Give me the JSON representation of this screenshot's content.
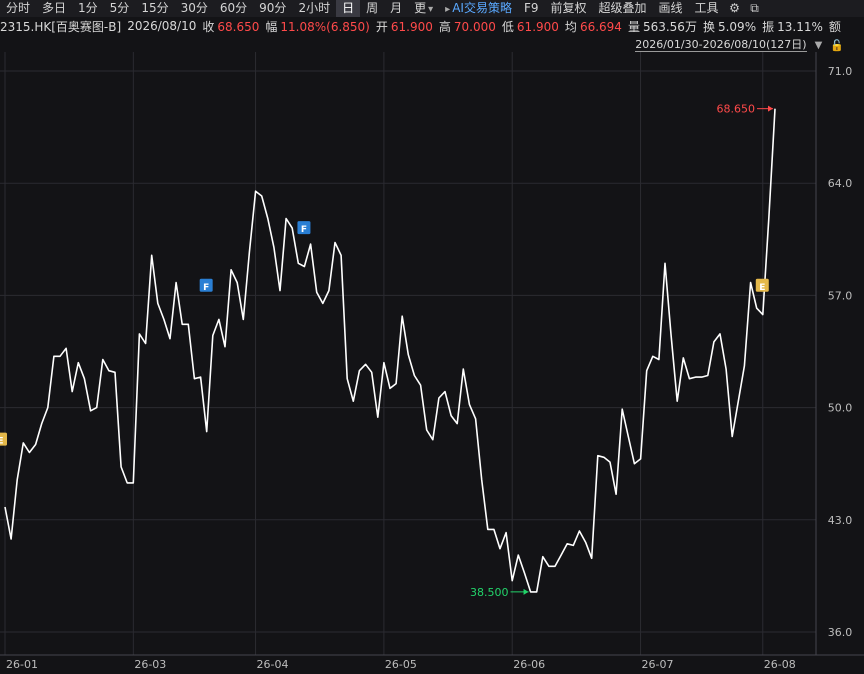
{
  "toolbar": {
    "items": [
      "分时",
      "多日",
      "1分",
      "5分",
      "15分",
      "30分",
      "60分",
      "90分",
      "2小时",
      "日",
      "周",
      "月",
      "更",
      "AI交易策略",
      "F9",
      "前复权",
      "超级叠加",
      "画线",
      "工具"
    ],
    "active": "日",
    "accent": "AI交易策略",
    "icons": [
      "gear-icon",
      "copy-icon"
    ]
  },
  "quote": {
    "symbol": "2315.HK[百奥赛图-B]",
    "date": "2026/08/10",
    "close_label": "收",
    "close": "68.650",
    "change_label": "幅",
    "change": "11.08%(6.850)",
    "open_label": "开",
    "open": "61.900",
    "high_label": "高",
    "high": "70.000",
    "low_label": "低",
    "low": "61.900",
    "avg_label": "均",
    "avg": "66.694",
    "volume_label": "量",
    "volume": "563.56万",
    "turnover_label": "换",
    "turnover": "5.09%",
    "amplitude_label": "振",
    "amplitude": "13.11%",
    "extra_label": "额"
  },
  "range": {
    "text": "2026/01/30-2026/08/10(127日)"
  },
  "colors": {
    "line": "#ffffff",
    "up": "#ff4a4a",
    "down": "#22d36a",
    "grid": "#2b2b31",
    "badgeF": "#2a7fd4",
    "badgeE": "#e4b84a"
  },
  "chart_data": {
    "type": "line",
    "x_ticks": [
      "26-01",
      "26-03",
      "26-04",
      "26-05",
      "26-06",
      "26-07",
      "26-08"
    ],
    "y_ticks": [
      "71.0",
      "64.0",
      "57.0",
      "50.0",
      "43.0",
      "36.0"
    ],
    "ylim": [
      36,
      71
    ],
    "grid": true,
    "values": [
      43.8,
      41.8,
      45.5,
      47.8,
      47.2,
      47.7,
      49.0,
      50.0,
      53.2,
      53.2,
      53.7,
      51.0,
      52.8,
      51.8,
      49.8,
      50.0,
      53.0,
      52.3,
      52.2,
      46.3,
      45.3,
      45.3,
      54.6,
      54.0,
      59.5,
      56.5,
      55.5,
      54.3,
      57.8,
      55.2,
      55.2,
      51.8,
      51.9,
      48.5,
      54.5,
      55.5,
      53.8,
      58.6,
      57.8,
      55.5,
      59.7,
      63.5,
      63.2,
      61.8,
      60.0,
      57.3,
      61.8,
      61.2,
      59.0,
      58.8,
      60.2,
      57.2,
      56.5,
      57.3,
      60.3,
      59.5,
      51.8,
      50.4,
      52.3,
      52.7,
      52.2,
      49.4,
      52.8,
      51.2,
      51.5,
      55.7,
      53.3,
      52.0,
      51.4,
      48.6,
      48.0,
      50.6,
      51.0,
      49.5,
      49.0,
      52.4,
      50.2,
      49.3,
      45.5,
      42.4,
      42.4,
      41.2,
      42.2,
      39.2,
      40.8,
      39.7,
      38.5,
      38.5,
      40.7,
      40.1,
      40.1,
      40.8,
      41.5,
      41.4,
      42.3,
      41.6,
      40.6,
      47.0,
      46.9,
      46.6,
      44.6,
      49.9,
      48.2,
      46.5,
      46.8,
      52.3,
      53.2,
      53.0,
      59.0,
      54.5,
      50.4,
      53.1,
      51.8,
      51.9,
      51.9,
      52.0,
      54.1,
      54.6,
      52.4,
      48.2,
      50.4,
      52.6,
      57.8,
      56.2,
      55.8,
      61.9,
      68.65
    ],
    "annotations": [
      {
        "label": "68.650",
        "value": 68.65,
        "type": "high"
      },
      {
        "label": "38.500",
        "value": 38.5,
        "type": "low"
      }
    ],
    "markers": [
      {
        "letter": "F",
        "value": 57.6
      },
      {
        "letter": "F",
        "value": 61.2
      },
      {
        "letter": "E",
        "value": 57.6
      },
      {
        "letter": "E",
        "value": 48.0
      }
    ]
  }
}
